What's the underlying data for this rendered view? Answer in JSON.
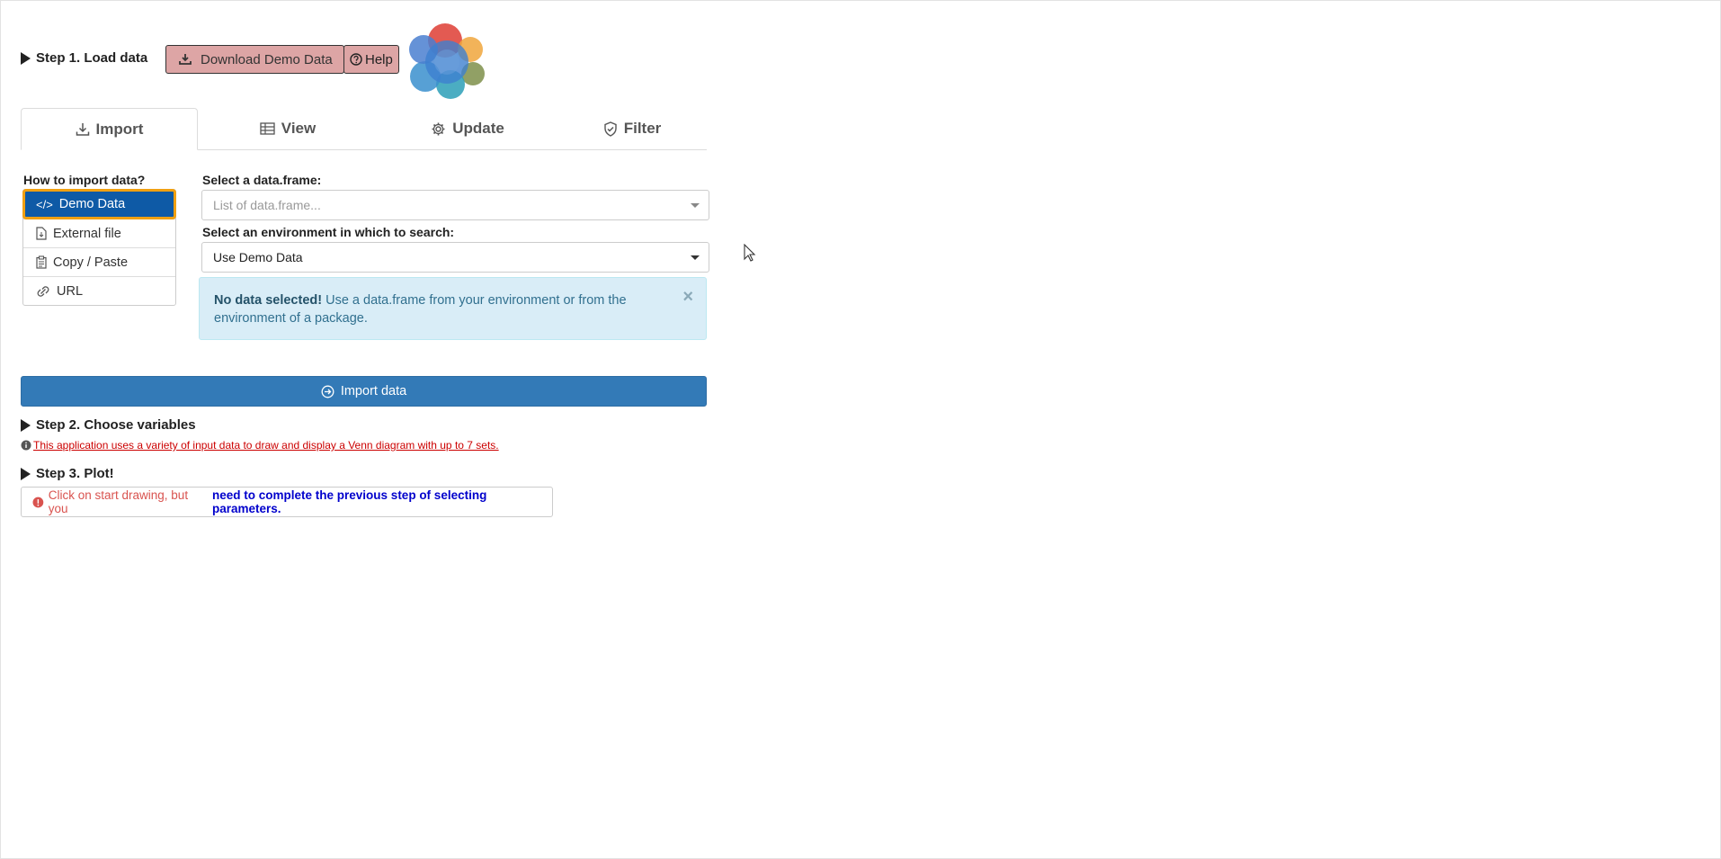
{
  "step1": {
    "title": "Step 1. Load data",
    "download_label": "Download Demo Data",
    "help_label": "Help"
  },
  "tabs": [
    {
      "label": "Import",
      "icon": "download-icon"
    },
    {
      "label": "View",
      "icon": "table-icon"
    },
    {
      "label": "Update",
      "icon": "gear-icon"
    },
    {
      "label": "Filter",
      "icon": "shield-check-icon"
    }
  ],
  "import": {
    "how_label": "How to import data?",
    "methods": [
      {
        "label": "Demo Data",
        "icon": "code-icon"
      },
      {
        "label": "External file",
        "icon": "file-icon"
      },
      {
        "label": "Copy / Paste",
        "icon": "clipboard-icon"
      },
      {
        "label": "URL",
        "icon": "link-icon"
      }
    ],
    "dataframe_label": "Select a data.frame:",
    "dataframe_placeholder": "List of data.frame...",
    "env_label": "Select an environment in which to search:",
    "env_value": "Use Demo Data",
    "alert_bold": "No data selected!",
    "alert_text": "Use a data.frame from your environment or from the environment of a package.",
    "alert_close": "×",
    "import_button": "Import data"
  },
  "step2": {
    "title": "Step 2. Choose variables",
    "info": "This application uses a variety of input data to draw and display a Venn diagram with up to 7 sets."
  },
  "step3": {
    "title": "Step 3. Plot!",
    "warn_red": "Click on start drawing, but you",
    "warn_blue": "need to complete the previous step of selecting parameters."
  },
  "colors": {
    "primary": "#337ab7",
    "active_item": "#0e5aa6",
    "focus_outline": "#f0a012",
    "demo_button": "#dda5a5",
    "alert_bg": "#d9edf7",
    "warning_red": "#d9534f",
    "link_red": "#cc0000",
    "warning_blue": "#0000cc"
  }
}
